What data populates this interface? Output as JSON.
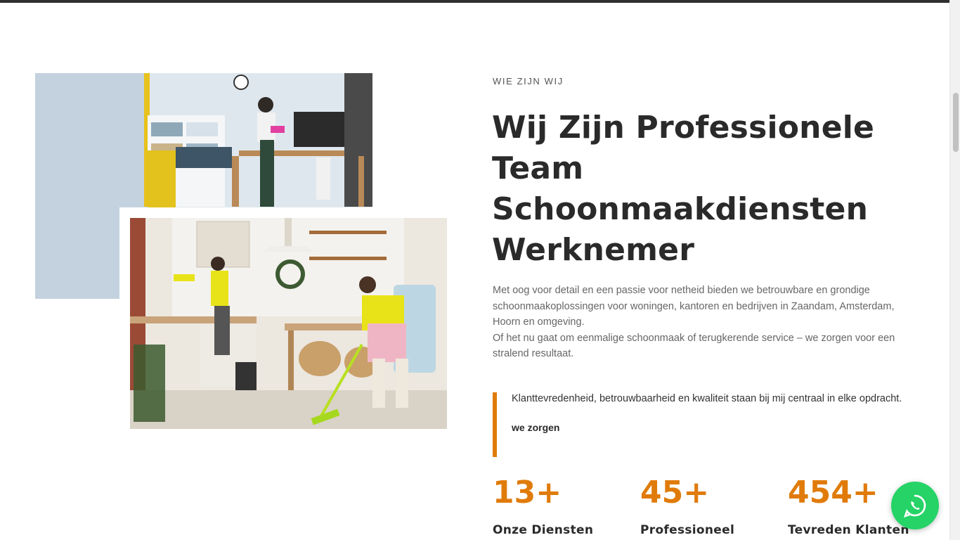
{
  "about": {
    "eyebrow": "WIE ZIJN WIJ",
    "heading_lines": [
      "Wij Zijn Professionele",
      "Team",
      "Schoonmaakdiensten",
      "Werknemer"
    ],
    "description_1": "Met oog voor detail en een passie voor netheid bieden we betrouwbare en grondige schoonmaakoplossingen voor woningen, kantoren en bedrijven in Zaandam, Amsterdam, Hoorn en omgeving.",
    "description_2": "Of het nu gaat om eenmalige schoonmaak of terugkerende service – we zorgen voor een stralend resultaat.",
    "quote_text": "Klanttevredenheid, betrouwbaarheid en kwaliteit staan bij mij centraal in elke opdracht.",
    "quote_signature": "we zorgen"
  },
  "stats": [
    {
      "value": "13+",
      "label": "Onze Diensten"
    },
    {
      "value": "45+",
      "label": "Professioneel"
    },
    {
      "value": "454+",
      "label": "Tevreden Klanten"
    }
  ],
  "images": {
    "back": "office-cleaning-photo",
    "front": "kitchen-cleaning-photo"
  },
  "floating": {
    "icon": "whatsapp-icon"
  },
  "colors": {
    "accent": "#e07b0a",
    "heading": "#2a2a2a",
    "body": "#666666",
    "whatsapp": "#25d366"
  }
}
